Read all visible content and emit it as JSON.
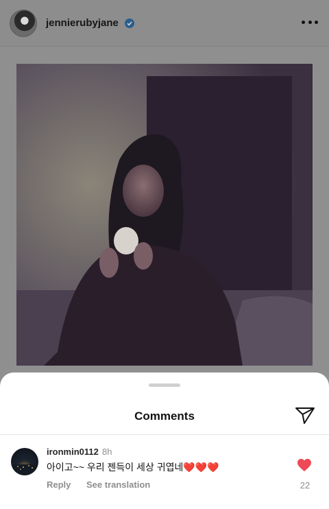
{
  "post": {
    "username": "jennierubyjane",
    "verified": true,
    "image_description_icon": "photo"
  },
  "sheet": {
    "title": "Comments"
  },
  "comment": {
    "username": "ironmin0112",
    "time": "8h",
    "text": "아이고~~ 우리 젠득이 세상 귀엽네",
    "hearts": "❤️❤️❤️",
    "reply_label": "Reply",
    "translate_label": "See translation",
    "like_count": "22"
  },
  "colors": {
    "like_red": "#ed4956",
    "verified_blue": "#2a5f8c"
  }
}
